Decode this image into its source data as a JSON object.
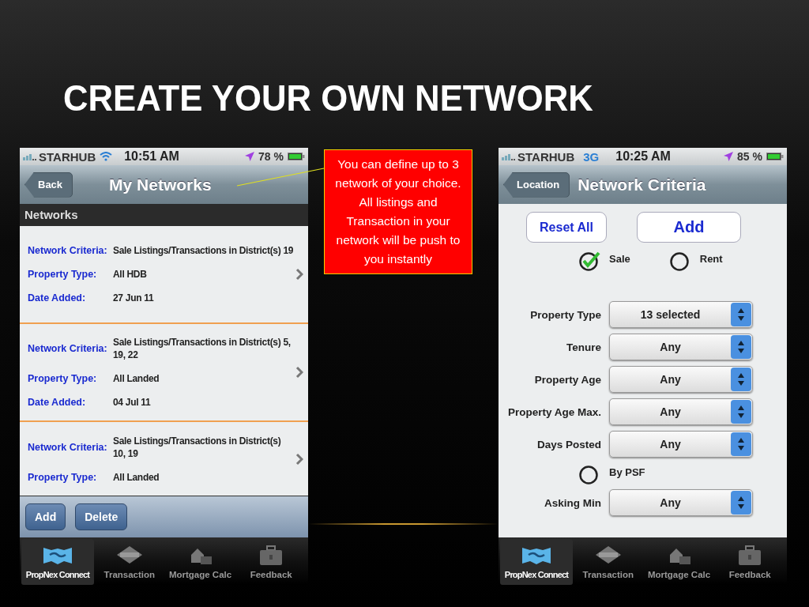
{
  "slide": {
    "title": "CREATE YOUR OWN NETWORK"
  },
  "left_phone": {
    "status_bar": {
      "carrier": "STARHUB",
      "network": {
        "kind": "wifi"
      },
      "time": "10:51 AM",
      "battery": "78 %"
    },
    "nav_bar": {
      "back": "Back",
      "title": "My Networks"
    },
    "section_header": "Networks",
    "networks": [
      {
        "fields": [
          {
            "label": "Network Criteria:",
            "value": "Sale Listings/Transactions in District(s) 19"
          },
          {
            "label": "Property Type:",
            "value": "All HDB"
          },
          {
            "label": "Date Added:",
            "value": "27 Jun 11"
          }
        ]
      },
      {
        "fields": [
          {
            "label": "Network Criteria:",
            "value": "Sale Listings/Transactions in District(s) 5, 19, 22"
          },
          {
            "label": "Property Type:",
            "value": "All Landed"
          },
          {
            "label": "Date Added:",
            "value": "04 Jul 11"
          }
        ]
      },
      {
        "fields": [
          {
            "label": "Network Criteria:",
            "value": "Sale Listings/Transactions in District(s) 10, 19"
          },
          {
            "label": "Property Type:",
            "value": "All Landed"
          }
        ]
      }
    ],
    "toolbar": [
      "Add",
      "Delete"
    ],
    "tab_bar": [
      {
        "label": "PropNex Connect",
        "selected": true
      },
      {
        "label": "Transaction",
        "selected": false
      },
      {
        "label": "Mortgage Calc",
        "selected": false
      },
      {
        "label": "Feedback",
        "selected": false
      }
    ]
  },
  "callout": {
    "text": "You can define up to 3 network of your choice. All listings and Transaction in your network will be push to you instantly"
  },
  "right_phone": {
    "status_bar": {
      "carrier": "STARHUB",
      "network": {
        "kind": "cellular",
        "label": "3G"
      },
      "time": "10:25 AM",
      "battery": "85 %"
    },
    "nav_bar": {
      "back": "Location",
      "title": "Network Criteria"
    },
    "buttons": [
      "Reset All",
      "Add"
    ],
    "listing_types": [
      {
        "label": "Sale",
        "checked": true
      },
      {
        "label": "Rent",
        "checked": false
      }
    ],
    "filters": [
      {
        "label": "Property Type",
        "value": "13 selected"
      },
      {
        "label": "Tenure",
        "value": "Any"
      },
      {
        "label": "Property Age",
        "value": "Any"
      },
      {
        "label": "Property Age Max.",
        "value": "Any"
      },
      {
        "label": "Days Posted",
        "value": "Any"
      }
    ],
    "psf_option": {
      "label": "By PSF",
      "checked": false
    },
    "more_filters": [
      {
        "label": "Asking Min",
        "value": "Any"
      }
    ],
    "tab_bar": [
      {
        "label": "PropNex Connect",
        "selected": true
      },
      {
        "label": "Transaction",
        "selected": false
      },
      {
        "label": "Mortgage Calc",
        "selected": false
      },
      {
        "label": "Feedback",
        "selected": false
      }
    ]
  }
}
